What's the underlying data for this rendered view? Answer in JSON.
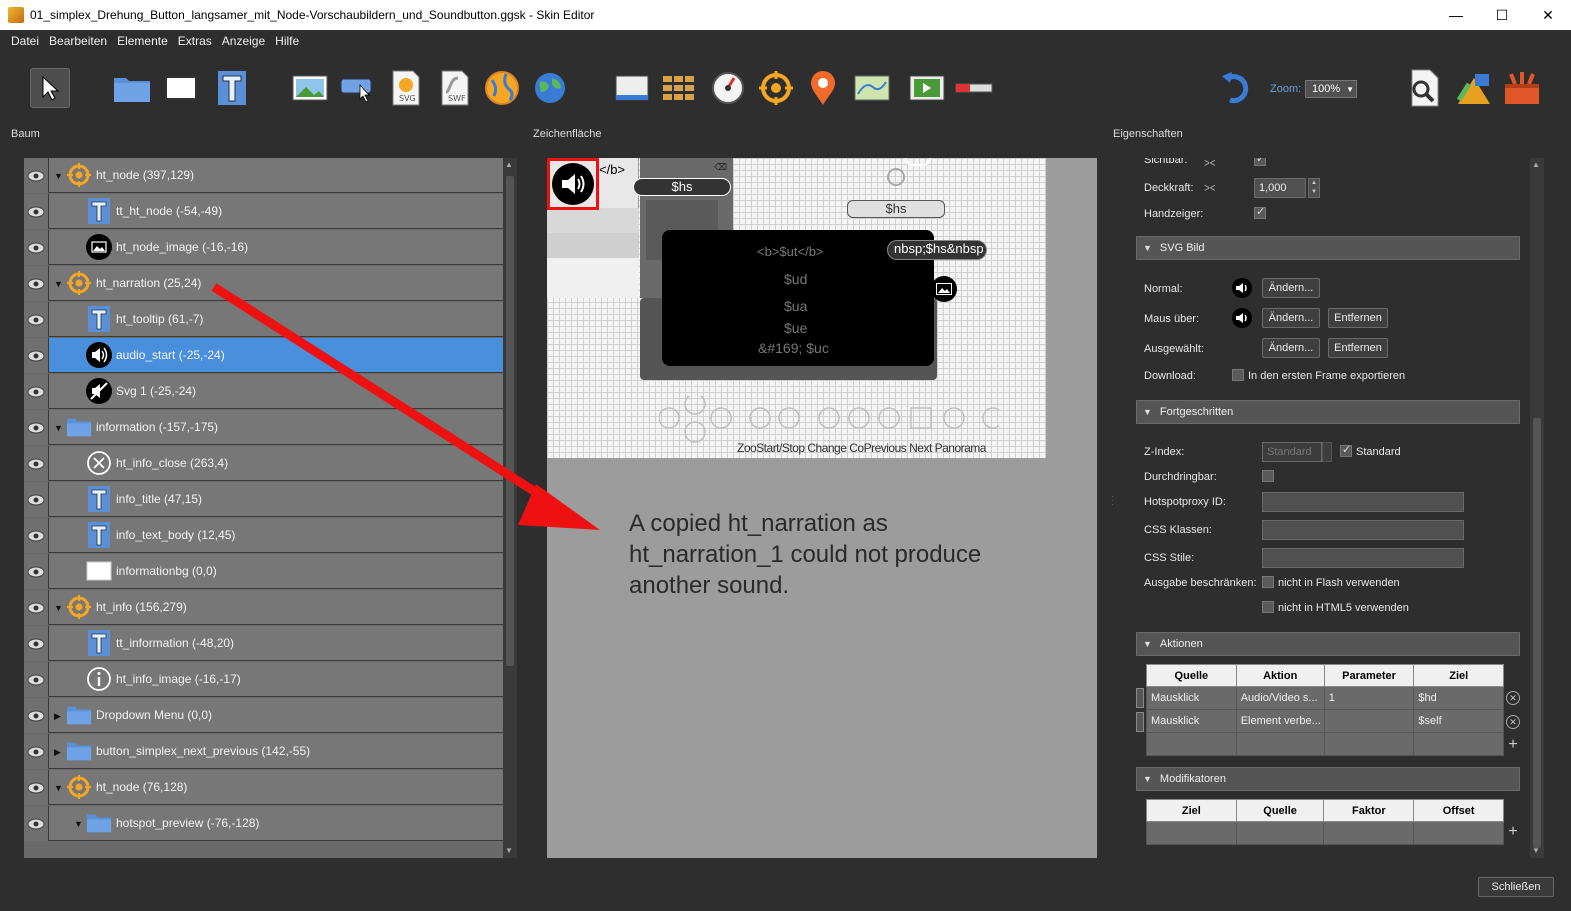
{
  "window": {
    "title": "01_simplex_Drehung_Button_langsamer_mit_Node-Vorschaubildern_und_Soundbutton.ggsk - Skin Editor",
    "minimize": "—",
    "maximize": "☐",
    "close": "✕"
  },
  "menu": [
    "Datei",
    "Bearbeiten",
    "Elemente",
    "Extras",
    "Anzeige",
    "Hilfe"
  ],
  "toolbar": {
    "zoom_label": "Zoom:",
    "zoom_value": "100%"
  },
  "panels": {
    "tree": "Baum",
    "canvas": "Zeichenfläche",
    "properties": "Eigenschaften"
  },
  "tree": [
    {
      "label": "ht_node (397,129)",
      "icon": "hotspot-icon",
      "level": 0,
      "expander": "▼"
    },
    {
      "label": "tt_ht_node (-54,-49)",
      "icon": "text-icon",
      "level": 1,
      "expander": ""
    },
    {
      "label": "ht_node_image (-16,-16)",
      "icon": "image-icon",
      "level": 1,
      "expander": ""
    },
    {
      "label": "ht_narration (25,24)",
      "icon": "hotspot-icon",
      "level": 0,
      "expander": "▼"
    },
    {
      "label": "ht_tooltip (61,-7)",
      "icon": "text-icon",
      "level": 1,
      "expander": ""
    },
    {
      "label": "audio_start (-25,-24)",
      "icon": "speaker-icon",
      "level": 1,
      "expander": "",
      "selected": true
    },
    {
      "label": "Svg 1 (-25,-24)",
      "icon": "speaker-mute-icon",
      "level": 1,
      "expander": ""
    },
    {
      "label": "information (-157,-175)",
      "icon": "folder-icon",
      "level": 0,
      "expander": "▼"
    },
    {
      "label": "ht_info_close (263,4)",
      "icon": "close-circle-icon",
      "level": 1,
      "expander": ""
    },
    {
      "label": "info_title (47,15)",
      "icon": "text-icon",
      "level": 1,
      "expander": ""
    },
    {
      "label": "info_text_body (12,45)",
      "icon": "text-icon",
      "level": 1,
      "expander": ""
    },
    {
      "label": "informationbg (0,0)",
      "icon": "rectangle-icon",
      "level": 1,
      "expander": ""
    },
    {
      "label": "ht_info (156,279)",
      "icon": "hotspot-icon",
      "level": 0,
      "expander": "▼"
    },
    {
      "label": "tt_information (-48,20)",
      "icon": "text-icon",
      "level": 1,
      "expander": ""
    },
    {
      "label": "ht_info_image (-16,-17)",
      "icon": "info-icon",
      "level": 1,
      "expander": ""
    },
    {
      "label": "Dropdown Menu (0,0)",
      "icon": "folder-icon",
      "level": 0,
      "expander": "▶"
    },
    {
      "label": "button_simplex_next_previous (142,-55)",
      "icon": "folder-icon",
      "level": 0,
      "expander": "▶"
    },
    {
      "label": "ht_node (76,128)",
      "icon": "hotspot-icon",
      "level": 0,
      "expander": "▼"
    },
    {
      "label": "hotspot_preview (-76,-128)",
      "icon": "folder-icon",
      "level": 1,
      "expander": "▼"
    }
  ],
  "canvas": {
    "stage_texts": {
      "b_close": "</b>",
      "hs1": "$hs",
      "hs2": "$hs",
      "ut": "<b>$ut</b>",
      "nbsp": "nbsp;$hs&nbsp",
      "ud": "$ud",
      "ua": "$ua",
      "ue": "$ue",
      "uc": "&#169; $uc",
      "overlap": "ZooStart/Stop Change CoPrevious Next Panorama"
    },
    "annotation": "A copied ht_narration as ht_narration_1 could not produce another sound."
  },
  "properties": {
    "sichtbar": "Sichtbar:",
    "deckkraft_label": "Deckkraft:",
    "deckkraft_value": "1,000",
    "handzeiger": "Handzeiger:",
    "svg_section": "SVG Bild",
    "normal": "Normal:",
    "maus_ueber": "Maus über:",
    "ausgewaehlt": "Ausgewählt:",
    "download": "Download:",
    "download_option": "In den ersten Frame exportieren",
    "aendern": "Ändern...",
    "entfernen": "Entfernen",
    "advanced_section": "Fortgeschritten",
    "zindex": "Z-Index:",
    "zindex_value": "Standard",
    "zindex_check": "Standard",
    "durchdringbar": "Durchdringbar:",
    "hotspotproxy": "Hotspotproxy ID:",
    "css_klassen": "CSS Klassen:",
    "css_stile": "CSS Stile:",
    "ausgabe": "Ausgabe beschränken:",
    "no_flash": "nicht in Flash verwenden",
    "no_html5": "nicht in HTML5 verwenden",
    "actions_section": "Aktionen",
    "actions_headers": [
      "Quelle",
      "Aktion",
      "Parameter",
      "Ziel"
    ],
    "actions_rows": [
      [
        "Mausklick",
        "Audio/Video s...",
        "1",
        "$hd"
      ],
      [
        "Mausklick",
        "Element verbe...",
        "",
        "$self"
      ],
      [
        "",
        "",
        "",
        ""
      ]
    ],
    "modifiers_section": "Modifikatoren",
    "modifiers_headers": [
      "Ziel",
      "Quelle",
      "Faktor",
      "Offset"
    ]
  },
  "footer": {
    "close": "Schließen"
  },
  "colors": {
    "selection": "#4a8fdc",
    "arrow": "#ee1111",
    "hotspot": "#f5a623",
    "folder": "#5b8fd6"
  }
}
